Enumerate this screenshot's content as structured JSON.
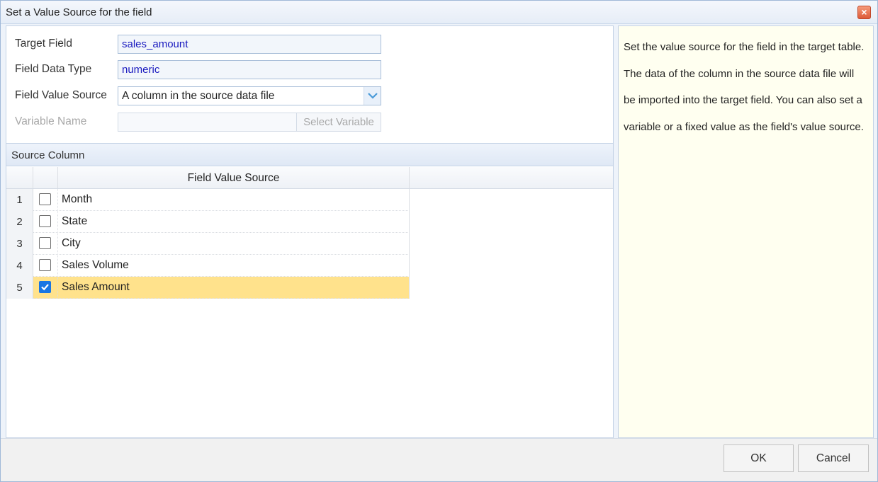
{
  "dialog": {
    "title": "Set a Value Source for the field",
    "close_symbol": "×"
  },
  "form": {
    "target_field_label": "Target Field",
    "target_field_value": "sales_amount",
    "data_type_label": "Field Data Type",
    "data_type_value": "numeric",
    "value_source_label": "Field Value Source",
    "value_source_value": "A column in the source data file",
    "variable_name_label": "Variable Name",
    "variable_name_value": "",
    "select_variable_label": "Select Variable"
  },
  "source_column": {
    "title": "Source Column",
    "column_header": "Field Value Source",
    "rows": [
      {
        "num": "1",
        "name": "Month",
        "checked": false
      },
      {
        "num": "2",
        "name": "State",
        "checked": false
      },
      {
        "num": "3",
        "name": "City",
        "checked": false
      },
      {
        "num": "4",
        "name": "Sales Volume",
        "checked": false
      },
      {
        "num": "5",
        "name": "Sales Amount",
        "checked": true
      }
    ]
  },
  "help": {
    "text": "Set the value source for the field in the target table. The data of the column in the source data file will be imported into the target field. You can also set a variable or a fixed value as the field's value source."
  },
  "buttons": {
    "ok": "OK",
    "cancel": "Cancel"
  },
  "colors": {
    "selected_row": "#ffe28c",
    "checkbox_checked": "#1976e3",
    "value_text": "#1a1abf"
  },
  "icons": {
    "close": "close-icon",
    "dropdown": "chevron-down-icon",
    "check": "check-icon"
  }
}
